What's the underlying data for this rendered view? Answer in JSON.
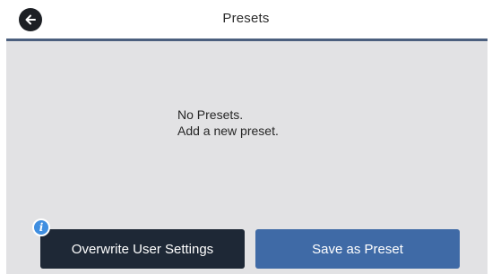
{
  "header": {
    "title": "Presets",
    "back_icon": "arrow-left-icon"
  },
  "content": {
    "empty_line1": "No Presets.",
    "empty_line2": "Add a new preset."
  },
  "footer": {
    "info_icon": "info-icon",
    "info_glyph": "i",
    "overwrite_label": "Overwrite User Settings",
    "save_label": "Save as Preset"
  },
  "colors": {
    "header_rule": "#4b5f7e",
    "panel_bg": "#e2e2e4",
    "overwrite_button": "#1e2836",
    "save_button": "#3f6aa6",
    "info_badge": "#3f8ee0"
  }
}
